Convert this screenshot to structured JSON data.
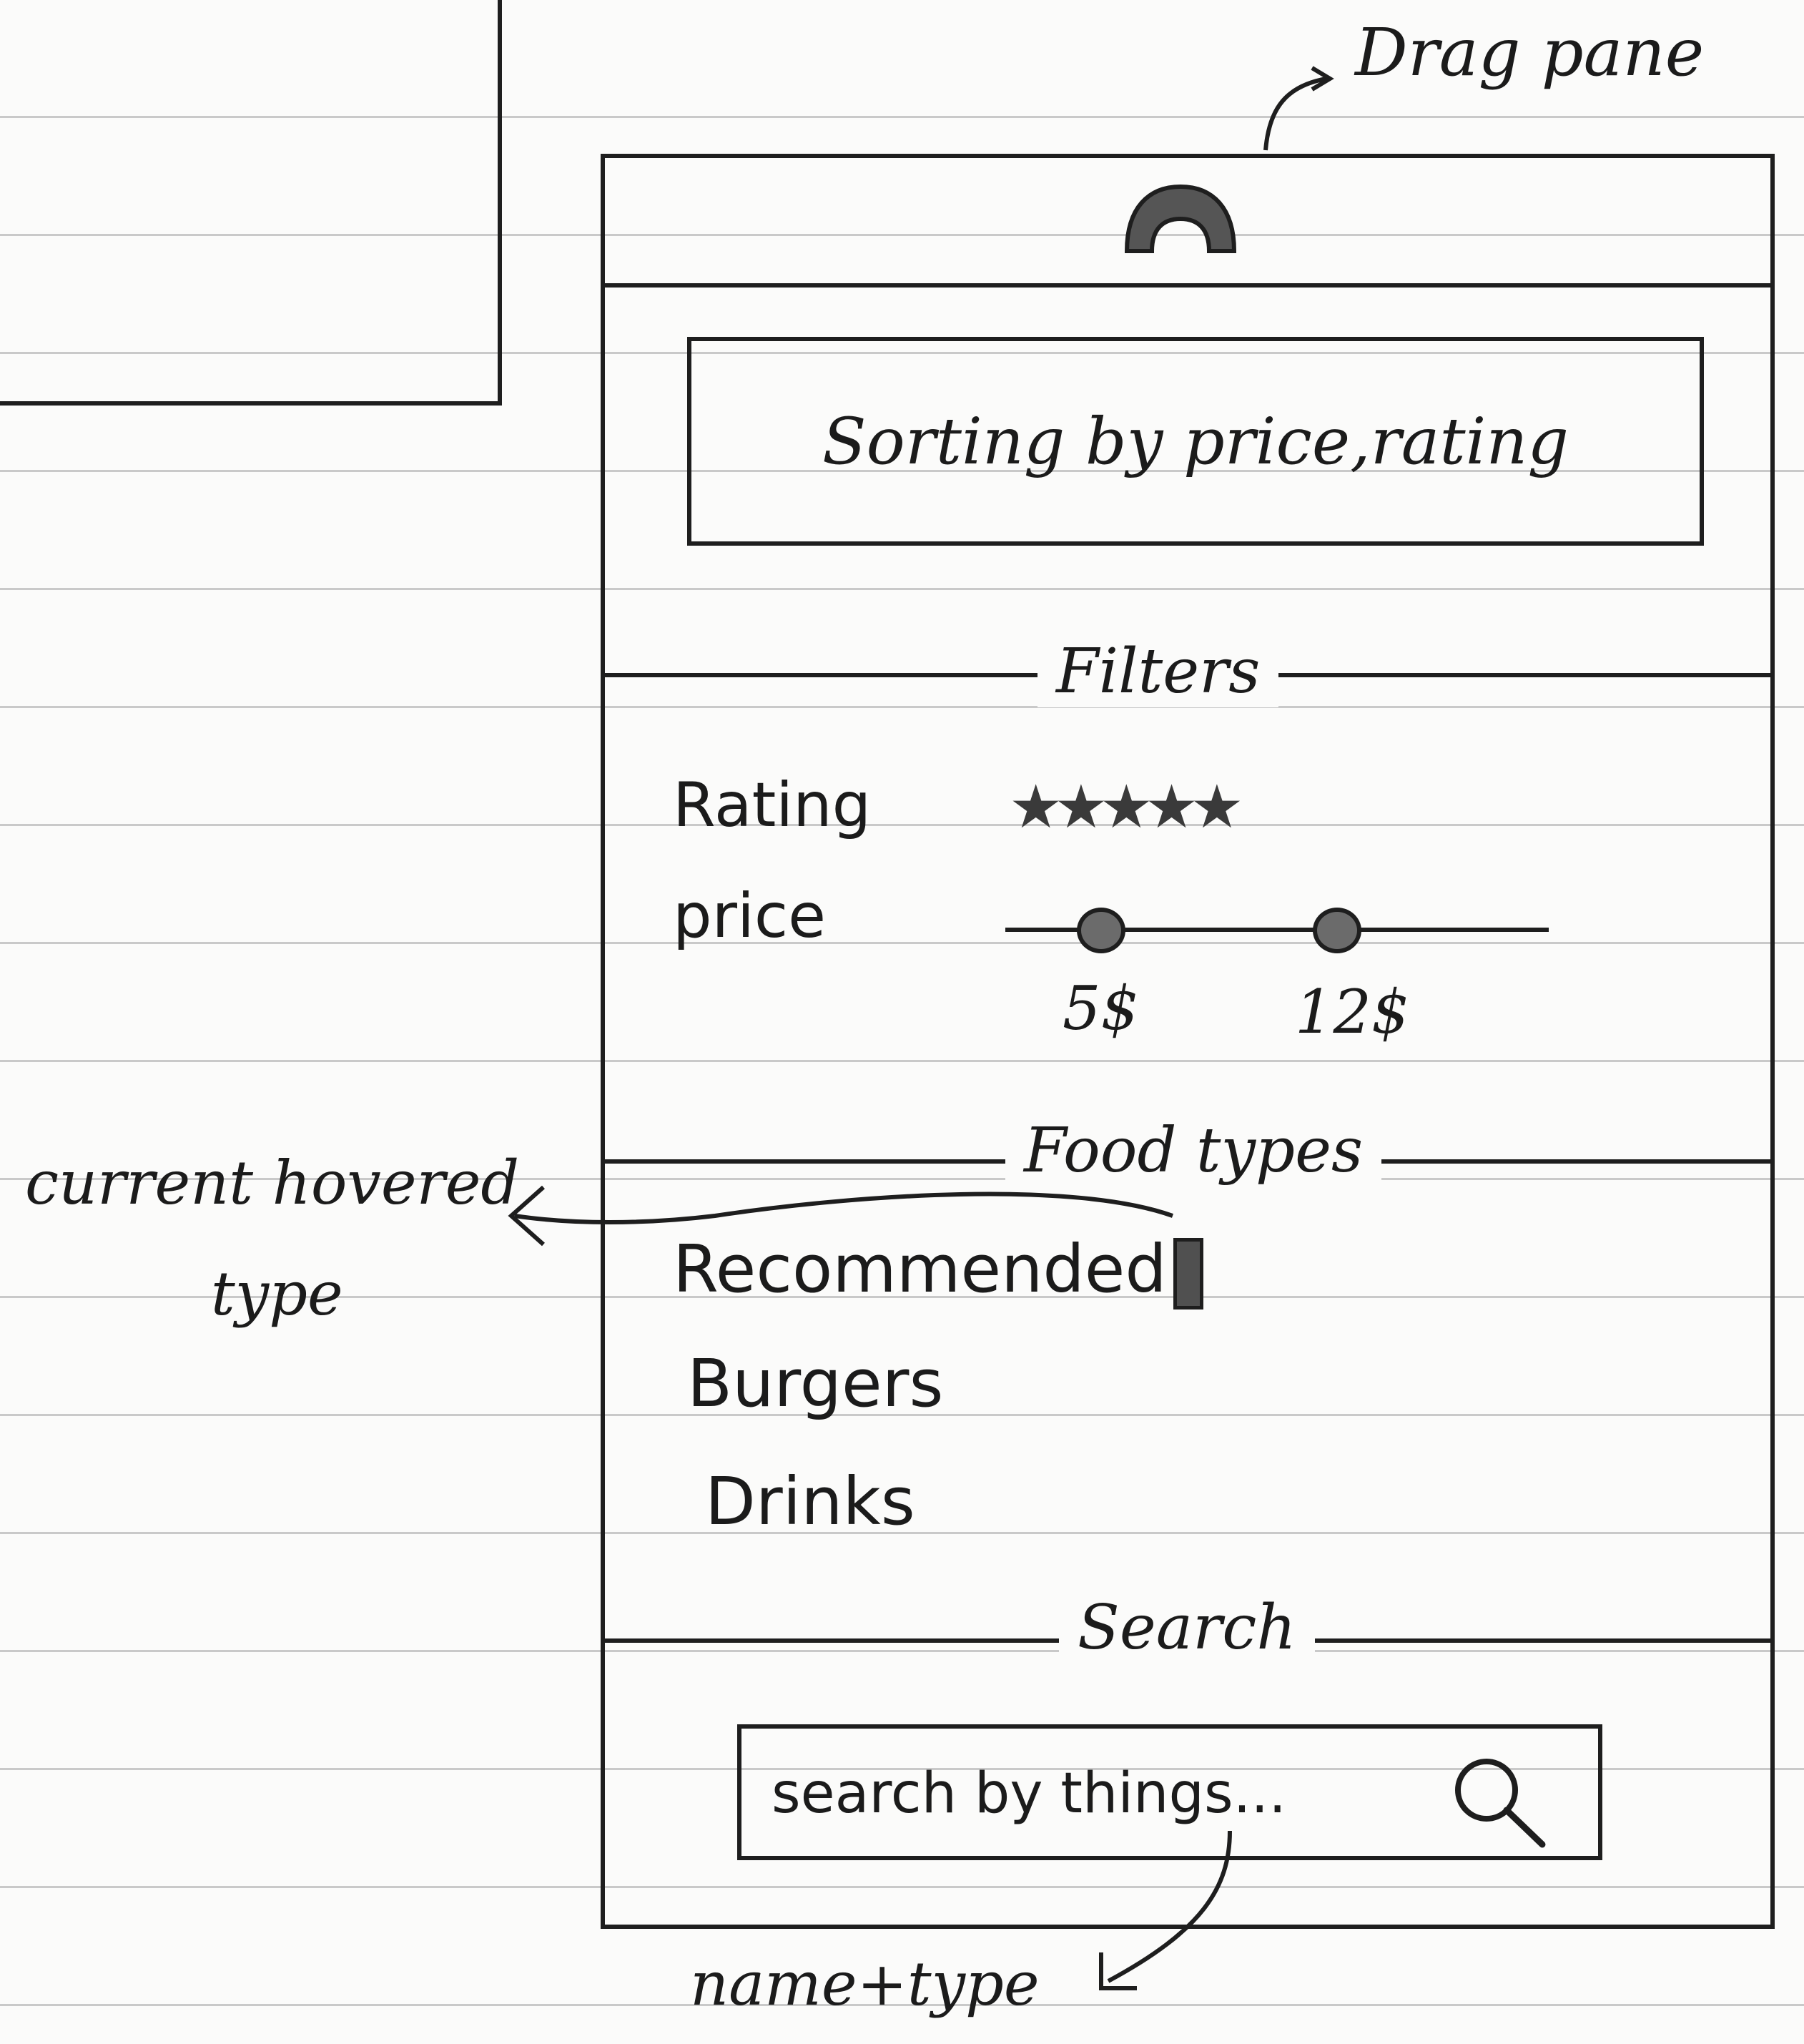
{
  "annotations": {
    "drag_pane": "Drag pane",
    "current_hovered_line1": "current hovered",
    "current_hovered_line2": "type",
    "search_note": "name+type"
  },
  "panel": {
    "drag_handle_icon": "drag-handle-icon",
    "sort_label": "Sorting by price,rating",
    "filters": {
      "title": "Filters",
      "rating_label": "Rating",
      "rating_stars": "★★★★★",
      "rating_value": 5,
      "rating_max": 5,
      "price_label": "price",
      "price_min": "5$",
      "price_max": "12$"
    },
    "food_types": {
      "title": "Food types",
      "items": [
        "Recommended",
        "Burgers",
        "Drinks"
      ],
      "hovered_index": 0
    },
    "search": {
      "title": "Search",
      "placeholder": "search by things...",
      "icon": "search-icon"
    }
  }
}
